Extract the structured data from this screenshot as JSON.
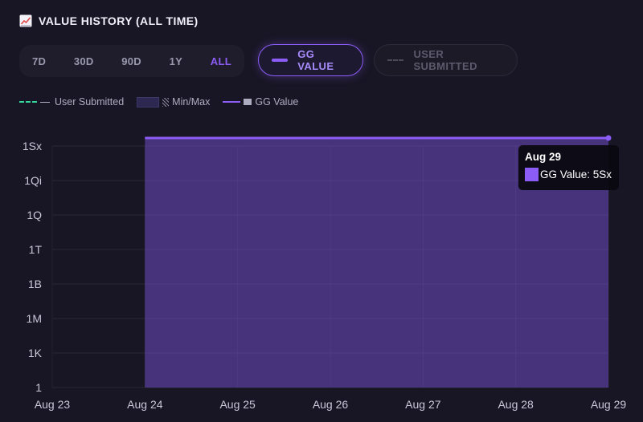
{
  "header": {
    "title": "VALUE HISTORY (ALL TIME)",
    "icon": "chart-increasing-icon"
  },
  "ranges": [
    {
      "label": "7D",
      "active": false
    },
    {
      "label": "30D",
      "active": false
    },
    {
      "label": "90D",
      "active": false
    },
    {
      "label": "1Y",
      "active": false
    },
    {
      "label": "ALL",
      "active": true
    }
  ],
  "toggles": {
    "gg_value": {
      "label": "GG VALUE",
      "active": true
    },
    "user_submitted": {
      "label": "USER SUBMITTED",
      "active": false
    }
  },
  "legend": {
    "user_submitted": "User Submitted",
    "min_max": "Min/Max",
    "gg_value": "GG Value"
  },
  "colors": {
    "accent": "#8b5cf6",
    "user_submitted": "#34d399",
    "background": "#181624"
  },
  "tooltip": {
    "date": "Aug 29",
    "label": "GG Value: 5Sx"
  },
  "chart_data": {
    "type": "area",
    "x": [
      "Aug 23",
      "Aug 24",
      "Aug 25",
      "Aug 26",
      "Aug 27",
      "Aug 28",
      "Aug 29"
    ],
    "y_scale": "log",
    "y_ticks": [
      "1",
      "1K",
      "1M",
      "1B",
      "1T",
      "1Q",
      "1Qi",
      "1Sx"
    ],
    "series": [
      {
        "name": "GG Value",
        "x": [
          "Aug 24",
          "Aug 29"
        ],
        "values": [
          5e+21,
          5e+21
        ]
      }
    ],
    "grid": true,
    "legend": "top-left"
  }
}
